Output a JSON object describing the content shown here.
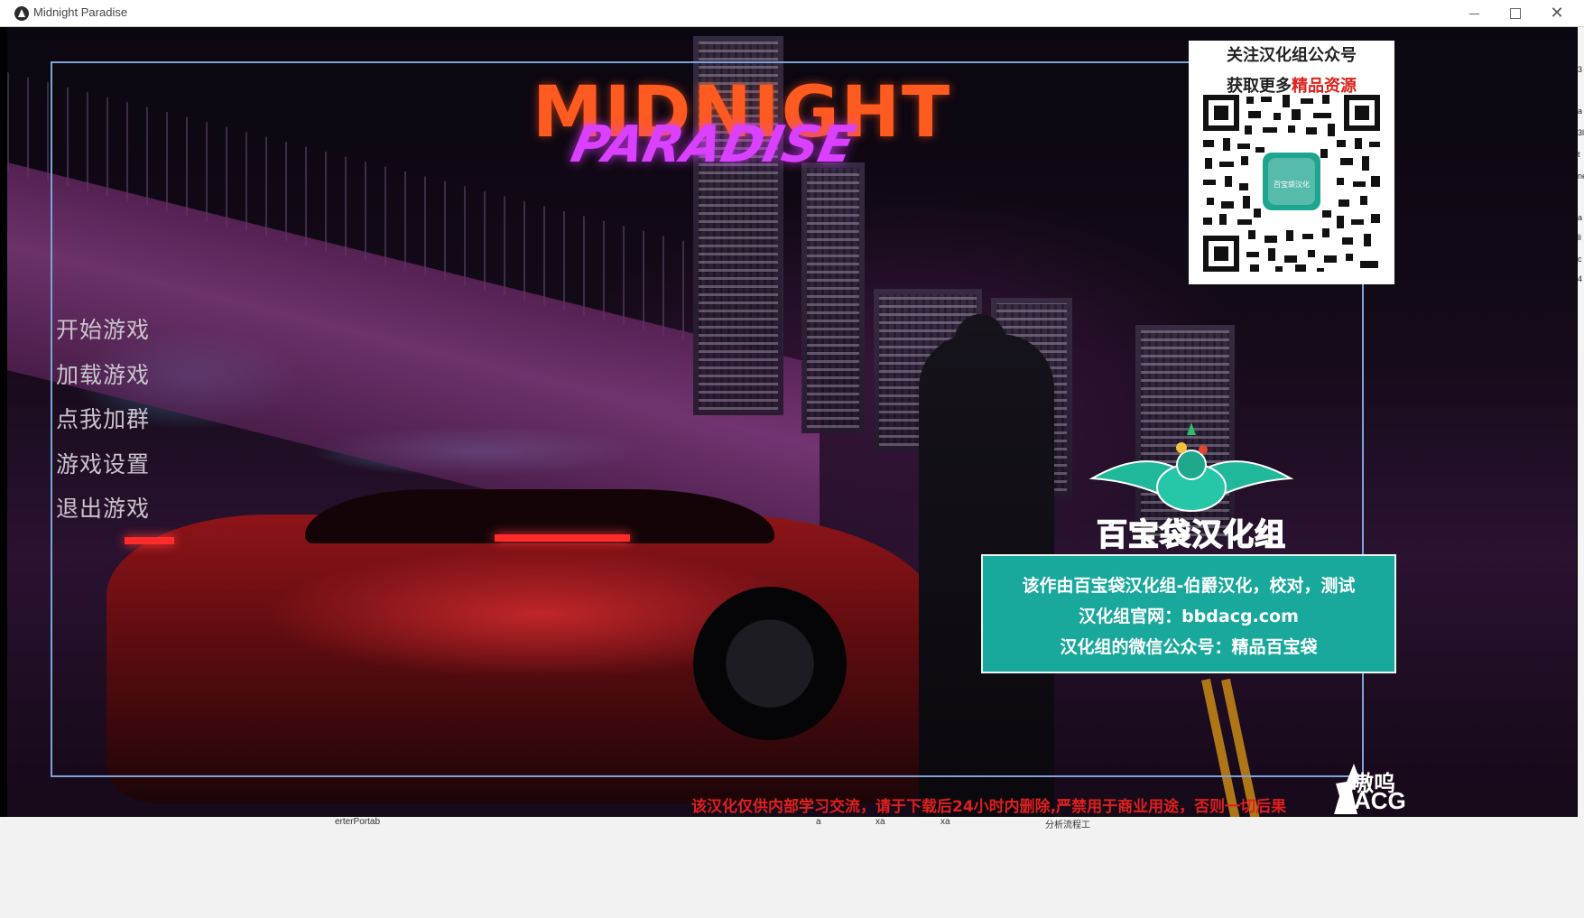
{
  "window": {
    "title": "Midnight Paradise",
    "controls": {
      "minimize": "—",
      "maximize": "☐",
      "close": "✕"
    }
  },
  "logo": {
    "line1": "MIDNIGHT",
    "line2": "PARADISE"
  },
  "menu": {
    "items": [
      {
        "label": "开始游戏"
      },
      {
        "label": "加载游戏"
      },
      {
        "label": "点我加群"
      },
      {
        "label": "游戏设置"
      },
      {
        "label": "退出游戏"
      }
    ]
  },
  "qr_card": {
    "line1": "关注汉化组公众号",
    "line2_prefix": "获取更多",
    "line2_highlight": "精品资源",
    "center_label": "百宝袋汉化"
  },
  "translator_group": {
    "name": "百宝袋汉化组",
    "info_lines": [
      "该作由百宝袋汉化组-伯爵汉化，校对，测试",
      "汉化组官网：bbdacg.com",
      "汉化组的微信公众号：精品百宝袋"
    ]
  },
  "disclaimer": "该汉化仅供内部学习交流，请于下载后24小时内删除,严禁用于商业用途，否则一切后果",
  "watermark": {
    "line1": "嗷呜",
    "line2": "ACG"
  },
  "taskbar_fragments": [
    "erterPortab",
    "a",
    "xa",
    "xa",
    "分析流程工"
  ],
  "right_strip_fragments": [
    "3",
    "a",
    "3l",
    "t",
    "ne",
    "a",
    "li",
    "c",
    "4"
  ],
  "colors": {
    "logo_orange": "#ff5a1f",
    "logo_magenta": "#d940ff",
    "frame_blue": "#7fa3d6",
    "info_teal": "#18a89c",
    "group_green": "#1ec3a6",
    "disclaimer_red": "#e01f1f"
  }
}
